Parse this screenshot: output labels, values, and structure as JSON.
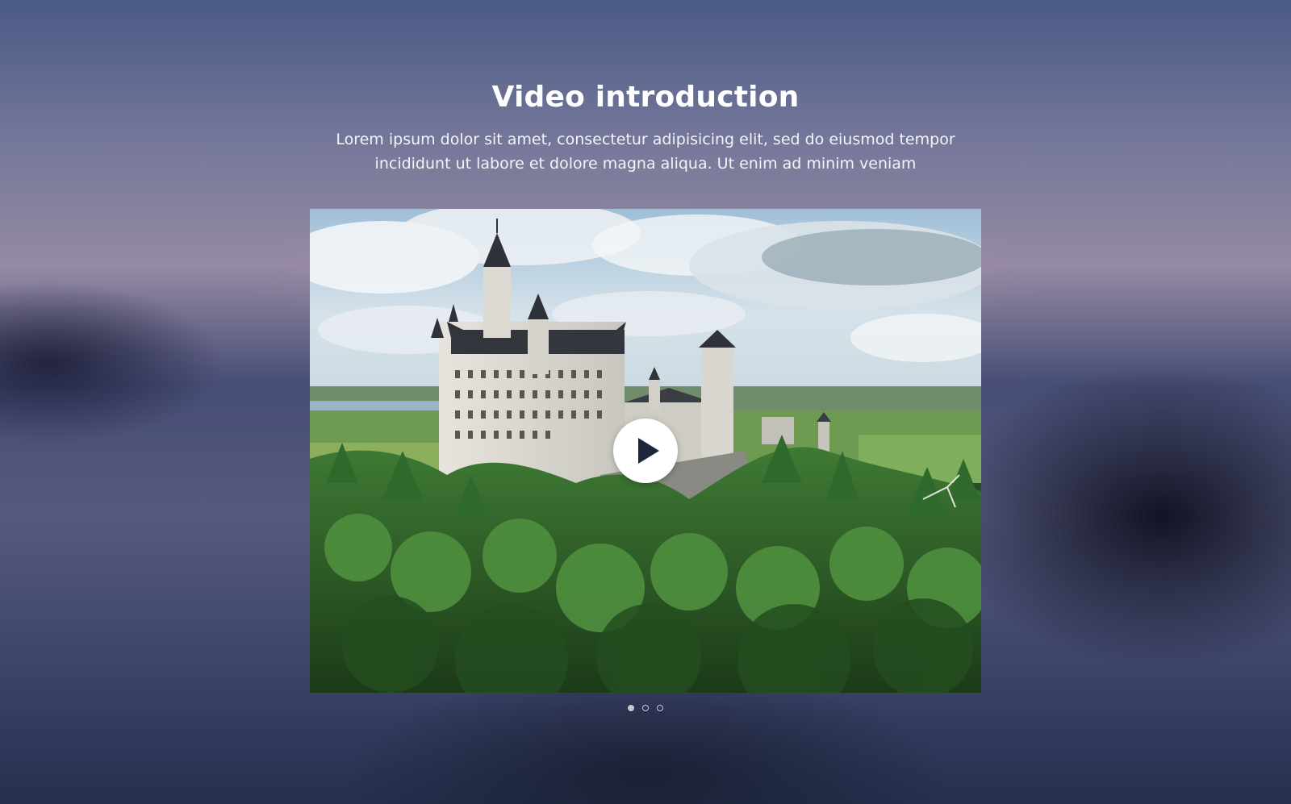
{
  "section": {
    "title": "Video introduction",
    "subtitle": "Lorem ipsum dolor sit amet, consectetur adipisicing elit, sed do eiusmod tempor incididunt ut labore et dolore magna aliqua. Ut enim ad minim veniam"
  },
  "video": {
    "thumbnail": "castle-landscape",
    "play_icon": "play-icon"
  },
  "carousel": {
    "dot_count": 3,
    "active_index": 0
  },
  "colors": {
    "text": "#ffffff",
    "play_button_bg": "#ffffff",
    "play_icon": "#21253a",
    "dot": "#c8c8d4"
  }
}
